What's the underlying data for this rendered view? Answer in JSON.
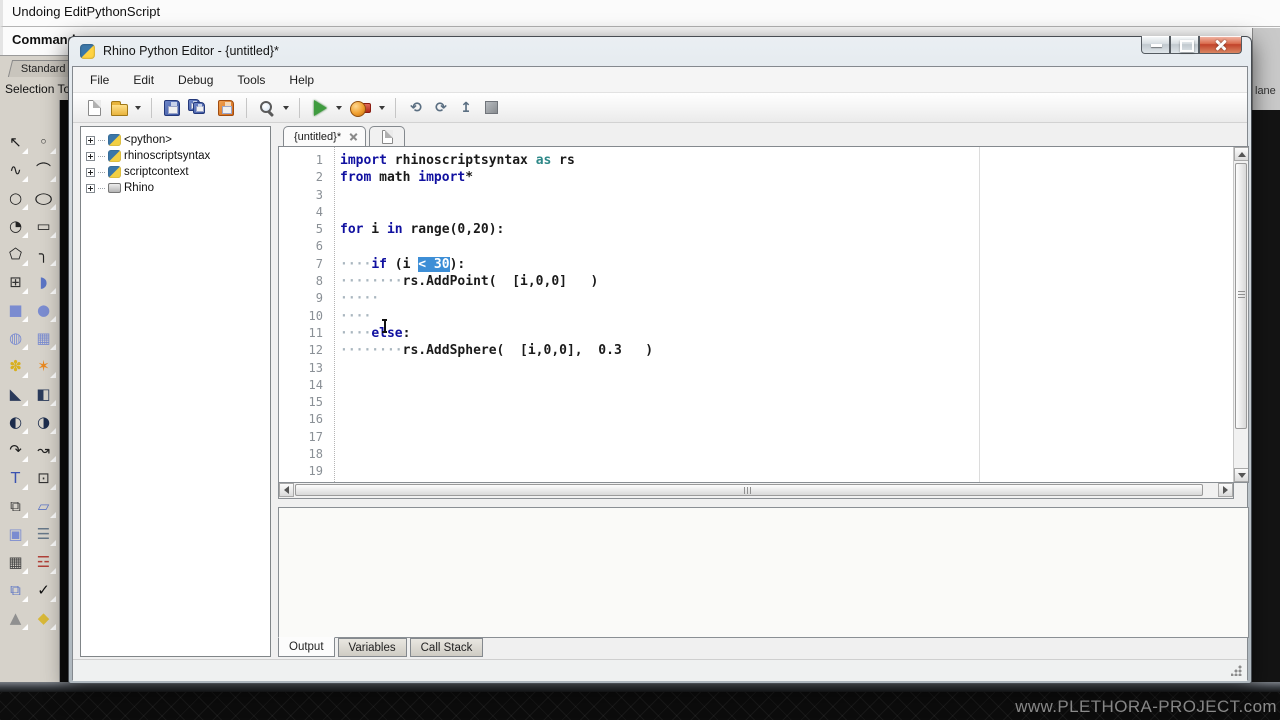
{
  "background": {
    "history_text": "Undoing EditPythonScript",
    "command_label": "Command:",
    "standard_tab": "Standard",
    "selection_label": "Selection To",
    "right_panel_label": "lane",
    "watermark": "www.PLETHORA-PROJECT.com",
    "left_toolbar_icons": [
      {
        "name": "select-pointer-icon",
        "glyph": "↖",
        "color": "#1a1a1a"
      },
      {
        "name": "point-icon",
        "glyph": "◦",
        "color": "#222222"
      },
      {
        "name": "curve-icon",
        "glyph": "∿",
        "color": "#222222"
      },
      {
        "name": "control-point-curve-icon",
        "glyph": "⌒",
        "color": "#222222"
      },
      {
        "name": "circle-icon",
        "glyph": "○",
        "color": "#222222"
      },
      {
        "name": "ellipse-icon",
        "glyph": "○",
        "color": "#222222",
        "wide": true
      },
      {
        "name": "arc-icon",
        "glyph": "◔",
        "color": "#222222"
      },
      {
        "name": "rectangle-icon",
        "glyph": "▭",
        "color": "#222222"
      },
      {
        "name": "polygon-icon",
        "glyph": "⬠",
        "color": "#222222"
      },
      {
        "name": "fillet-curve-icon",
        "glyph": "╮",
        "color": "#222222"
      },
      {
        "name": "surface-points-icon",
        "glyph": "⊞",
        "color": "#333333"
      },
      {
        "name": "curved-surface-icon",
        "glyph": "◗",
        "color": "#5b74c4"
      },
      {
        "name": "box-icon",
        "glyph": "■",
        "color": "#7b8cd0"
      },
      {
        "name": "sphere-icon",
        "glyph": "●",
        "color": "#7b8cd0"
      },
      {
        "name": "cylinder-icon",
        "glyph": "◍",
        "color": "#7b8cd0"
      },
      {
        "name": "mesh-icon",
        "glyph": "▦",
        "color": "#7b8cd0"
      },
      {
        "name": "explode-icon",
        "glyph": "✽",
        "color": "#d8b020"
      },
      {
        "name": "boom-icon",
        "glyph": "✶",
        "color": "#e88820"
      },
      {
        "name": "trim-icon",
        "glyph": "◣",
        "color": "#2a3a5a"
      },
      {
        "name": "split-icon",
        "glyph": "◧",
        "color": "#2a3a5a"
      },
      {
        "name": "boolean-union-icon",
        "glyph": "◐",
        "color": "#1c2c4c"
      },
      {
        "name": "boolean-difference-icon",
        "glyph": "◑",
        "color": "#1c2c4c"
      },
      {
        "name": "blend-curve-icon",
        "glyph": "↷",
        "color": "#222222"
      },
      {
        "name": "rebuild-curve-icon",
        "glyph": "↝",
        "color": "#222222"
      },
      {
        "name": "text-icon",
        "glyph": "T",
        "color": "#3a52b0"
      },
      {
        "name": "edit-point-icon",
        "glyph": "⊡",
        "color": "#333333"
      },
      {
        "name": "block-icon",
        "glyph": "⧉",
        "color": "#333333"
      },
      {
        "name": "plane-icon",
        "glyph": "▱",
        "color": "#5b74c4"
      },
      {
        "name": "extrude-icon",
        "glyph": "▣",
        "color": "#7b8cd0"
      },
      {
        "name": "hatch-icon",
        "glyph": "☰",
        "color": "#667788"
      },
      {
        "name": "array-icon",
        "glyph": "▦",
        "color": "#444444"
      },
      {
        "name": "section-icon",
        "glyph": "☲",
        "color": "#b04038"
      },
      {
        "name": "copy-icon",
        "glyph": "⧉",
        "color": "#5b74c4"
      },
      {
        "name": "check-icon",
        "glyph": "✓",
        "color": "#111111"
      },
      {
        "name": "cone-icon",
        "glyph": "▲",
        "color": "#909090"
      },
      {
        "name": "gumball-icon",
        "glyph": "◆",
        "color": "#d8b838"
      }
    ]
  },
  "window": {
    "title": "Rhino Python Editor - {untitled}*",
    "menu": [
      "File",
      "Edit",
      "Debug",
      "Tools",
      "Help"
    ],
    "toolbar_items": [
      "new-file",
      "open-file",
      "save-file",
      "save-all",
      "save-as",
      "search",
      "run-script",
      "debug-record",
      "step-into",
      "step-over",
      "step-out",
      "stop-debug"
    ],
    "step_glyphs": [
      "⟲",
      "⟳",
      "↥"
    ],
    "tree": [
      {
        "icon": "python",
        "label": "<python>"
      },
      {
        "icon": "python",
        "label": "rhinoscriptsyntax"
      },
      {
        "icon": "python",
        "label": "scriptcontext"
      },
      {
        "icon": "rhino",
        "label": "Rhino"
      }
    ],
    "doc_tab": "{untitled}*",
    "bottom_tabs": [
      "Output",
      "Variables",
      "Call Stack"
    ],
    "editor": {
      "lines": [
        {
          "n": "1",
          "segs": [
            [
              "kw",
              "import"
            ],
            [
              "p",
              " rhinoscriptsyntax "
            ],
            [
              "as",
              "as"
            ],
            [
              "p",
              " rs"
            ]
          ]
        },
        {
          "n": "2",
          "segs": [
            [
              "kw",
              "from"
            ],
            [
              "p",
              " math "
            ],
            [
              "kw",
              "import"
            ],
            [
              "p",
              "*"
            ]
          ]
        },
        {
          "n": "3",
          "segs": []
        },
        {
          "n": "4",
          "segs": []
        },
        {
          "n": "5",
          "segs": [
            [
              "kw",
              "for"
            ],
            [
              "p",
              " i "
            ],
            [
              "kw",
              "in"
            ],
            [
              "p",
              " range(0,20):"
            ]
          ]
        },
        {
          "n": "6",
          "segs": []
        },
        {
          "n": "7",
          "segs": [
            [
              "ws",
              "····"
            ],
            [
              "kw",
              "if"
            ],
            [
              "p",
              " (i "
            ],
            [
              "sel",
              "< 30"
            ],
            [
              "p",
              "):"
            ]
          ]
        },
        {
          "n": "8",
          "segs": [
            [
              "ws",
              "········"
            ],
            [
              "p",
              "rs.AddPoint(  [i,0,0]   )"
            ]
          ]
        },
        {
          "n": "9",
          "segs": [
            [
              "ws",
              "·····"
            ]
          ]
        },
        {
          "n": "10",
          "segs": [
            [
              "ws",
              "····"
            ]
          ]
        },
        {
          "n": "11",
          "segs": [
            [
              "ws",
              "····"
            ],
            [
              "kw",
              "else"
            ],
            [
              "p",
              ":"
            ]
          ]
        },
        {
          "n": "12",
          "segs": [
            [
              "ws",
              "········"
            ],
            [
              "p",
              "rs.AddSphere(  [i,0,0],  0.3   )"
            ]
          ]
        },
        {
          "n": "13",
          "segs": []
        },
        {
          "n": "14",
          "segs": []
        },
        {
          "n": "15",
          "segs": []
        },
        {
          "n": "16",
          "segs": []
        },
        {
          "n": "17",
          "segs": []
        },
        {
          "n": "18",
          "segs": []
        },
        {
          "n": "19",
          "segs": []
        }
      ]
    },
    "colors": {
      "keyword": "#1010a0",
      "as_keyword": "#2e8888",
      "selection_bg": "#3d8ed6",
      "selection_text": "#ffffff",
      "whitespace_dots": "#a9b6bf",
      "close_button": "#c1422a",
      "run_green": "#3f9c3f",
      "record_orange": "#f0a030",
      "folder_yellow": "#e8b43c",
      "floppy_blue": "#3a55a0",
      "floppy_orange": "#d06818"
    }
  }
}
